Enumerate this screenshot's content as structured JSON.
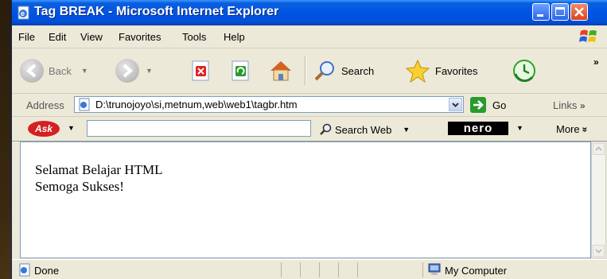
{
  "window": {
    "title": "Tag BREAK - Microsoft Internet Explorer"
  },
  "menu": {
    "items": [
      "File",
      "Edit",
      "View",
      "Favorites",
      "Tools",
      "Help"
    ]
  },
  "toolbar": {
    "back_label": "Back",
    "search_label": "Search",
    "favorites_label": "Favorites",
    "more_chevron": "»"
  },
  "address": {
    "label": "Address",
    "value": "D:\\trunojoyo\\si,metnum,web\\web1\\tagbr.htm",
    "go_label": "Go",
    "links_label": "Links",
    "links_chevron": "»"
  },
  "askbar": {
    "logo": "Ask",
    "search_value": "",
    "search_web_label": "Search Web",
    "nero_label": "nero",
    "more_label": "More",
    "more_chevron": "»"
  },
  "content": {
    "lines": [
      "Selamat Belajar HTML",
      "Semoga Sukses!"
    ]
  },
  "status": {
    "text": "Done",
    "zone": "My Computer"
  },
  "colors": {
    "titlebar": "#0054e3",
    "window_bg": "#ece9d8",
    "content_bg": "#ffffff"
  }
}
